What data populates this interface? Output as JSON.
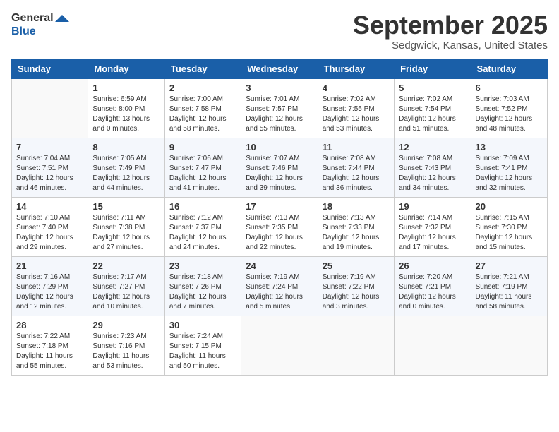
{
  "header": {
    "logo_general": "General",
    "logo_blue": "Blue",
    "month_title": "September 2025",
    "location": "Sedgwick, Kansas, United States"
  },
  "days_of_week": [
    "Sunday",
    "Monday",
    "Tuesday",
    "Wednesday",
    "Thursday",
    "Friday",
    "Saturday"
  ],
  "weeks": [
    [
      {
        "day": "",
        "info": ""
      },
      {
        "day": "1",
        "info": "Sunrise: 6:59 AM\nSunset: 8:00 PM\nDaylight: 13 hours\nand 0 minutes."
      },
      {
        "day": "2",
        "info": "Sunrise: 7:00 AM\nSunset: 7:58 PM\nDaylight: 12 hours\nand 58 minutes."
      },
      {
        "day": "3",
        "info": "Sunrise: 7:01 AM\nSunset: 7:57 PM\nDaylight: 12 hours\nand 55 minutes."
      },
      {
        "day": "4",
        "info": "Sunrise: 7:02 AM\nSunset: 7:55 PM\nDaylight: 12 hours\nand 53 minutes."
      },
      {
        "day": "5",
        "info": "Sunrise: 7:02 AM\nSunset: 7:54 PM\nDaylight: 12 hours\nand 51 minutes."
      },
      {
        "day": "6",
        "info": "Sunrise: 7:03 AM\nSunset: 7:52 PM\nDaylight: 12 hours\nand 48 minutes."
      }
    ],
    [
      {
        "day": "7",
        "info": "Sunrise: 7:04 AM\nSunset: 7:51 PM\nDaylight: 12 hours\nand 46 minutes."
      },
      {
        "day": "8",
        "info": "Sunrise: 7:05 AM\nSunset: 7:49 PM\nDaylight: 12 hours\nand 44 minutes."
      },
      {
        "day": "9",
        "info": "Sunrise: 7:06 AM\nSunset: 7:47 PM\nDaylight: 12 hours\nand 41 minutes."
      },
      {
        "day": "10",
        "info": "Sunrise: 7:07 AM\nSunset: 7:46 PM\nDaylight: 12 hours\nand 39 minutes."
      },
      {
        "day": "11",
        "info": "Sunrise: 7:08 AM\nSunset: 7:44 PM\nDaylight: 12 hours\nand 36 minutes."
      },
      {
        "day": "12",
        "info": "Sunrise: 7:08 AM\nSunset: 7:43 PM\nDaylight: 12 hours\nand 34 minutes."
      },
      {
        "day": "13",
        "info": "Sunrise: 7:09 AM\nSunset: 7:41 PM\nDaylight: 12 hours\nand 32 minutes."
      }
    ],
    [
      {
        "day": "14",
        "info": "Sunrise: 7:10 AM\nSunset: 7:40 PM\nDaylight: 12 hours\nand 29 minutes."
      },
      {
        "day": "15",
        "info": "Sunrise: 7:11 AM\nSunset: 7:38 PM\nDaylight: 12 hours\nand 27 minutes."
      },
      {
        "day": "16",
        "info": "Sunrise: 7:12 AM\nSunset: 7:37 PM\nDaylight: 12 hours\nand 24 minutes."
      },
      {
        "day": "17",
        "info": "Sunrise: 7:13 AM\nSunset: 7:35 PM\nDaylight: 12 hours\nand 22 minutes."
      },
      {
        "day": "18",
        "info": "Sunrise: 7:13 AM\nSunset: 7:33 PM\nDaylight: 12 hours\nand 19 minutes."
      },
      {
        "day": "19",
        "info": "Sunrise: 7:14 AM\nSunset: 7:32 PM\nDaylight: 12 hours\nand 17 minutes."
      },
      {
        "day": "20",
        "info": "Sunrise: 7:15 AM\nSunset: 7:30 PM\nDaylight: 12 hours\nand 15 minutes."
      }
    ],
    [
      {
        "day": "21",
        "info": "Sunrise: 7:16 AM\nSunset: 7:29 PM\nDaylight: 12 hours\nand 12 minutes."
      },
      {
        "day": "22",
        "info": "Sunrise: 7:17 AM\nSunset: 7:27 PM\nDaylight: 12 hours\nand 10 minutes."
      },
      {
        "day": "23",
        "info": "Sunrise: 7:18 AM\nSunset: 7:26 PM\nDaylight: 12 hours\nand 7 minutes."
      },
      {
        "day": "24",
        "info": "Sunrise: 7:19 AM\nSunset: 7:24 PM\nDaylight: 12 hours\nand 5 minutes."
      },
      {
        "day": "25",
        "info": "Sunrise: 7:19 AM\nSunset: 7:22 PM\nDaylight: 12 hours\nand 3 minutes."
      },
      {
        "day": "26",
        "info": "Sunrise: 7:20 AM\nSunset: 7:21 PM\nDaylight: 12 hours\nand 0 minutes."
      },
      {
        "day": "27",
        "info": "Sunrise: 7:21 AM\nSunset: 7:19 PM\nDaylight: 11 hours\nand 58 minutes."
      }
    ],
    [
      {
        "day": "28",
        "info": "Sunrise: 7:22 AM\nSunset: 7:18 PM\nDaylight: 11 hours\nand 55 minutes."
      },
      {
        "day": "29",
        "info": "Sunrise: 7:23 AM\nSunset: 7:16 PM\nDaylight: 11 hours\nand 53 minutes."
      },
      {
        "day": "30",
        "info": "Sunrise: 7:24 AM\nSunset: 7:15 PM\nDaylight: 11 hours\nand 50 minutes."
      },
      {
        "day": "",
        "info": ""
      },
      {
        "day": "",
        "info": ""
      },
      {
        "day": "",
        "info": ""
      },
      {
        "day": "",
        "info": ""
      }
    ]
  ]
}
